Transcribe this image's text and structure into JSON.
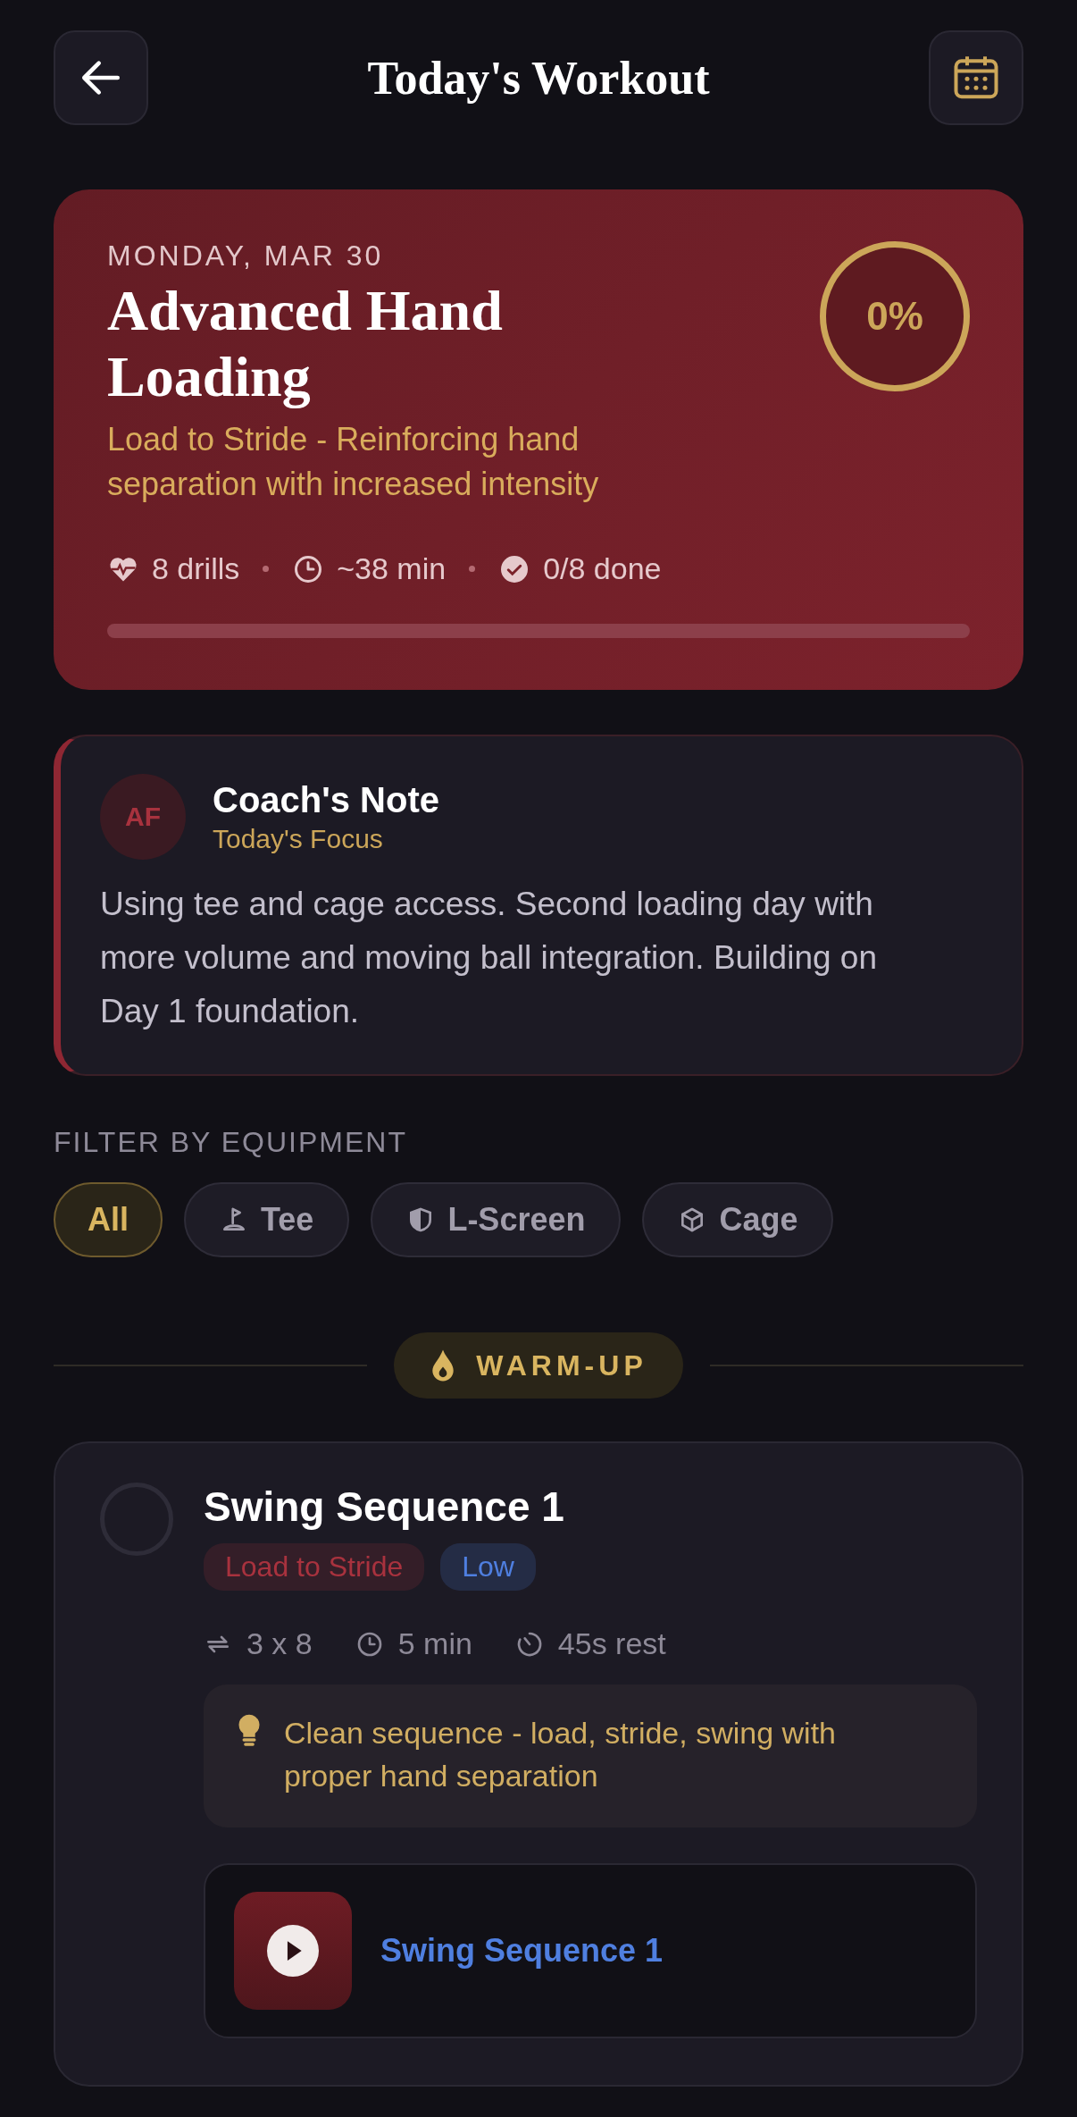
{
  "header": {
    "title": "Today's Workout"
  },
  "hero": {
    "date": "MONDAY, MAR 30",
    "title": "Advanced Hand Loading",
    "subtitle": "Load to Stride - Reinforcing hand separation with increased intensity",
    "percent": "0%",
    "stats": [
      {
        "kind": "drills",
        "text": "8 drills"
      },
      {
        "kind": "time",
        "text": "~38 min"
      },
      {
        "kind": "done",
        "text": "0/8 done"
      }
    ],
    "progress": {
      "level": 0
    }
  },
  "coach_note": {
    "initials": "AF",
    "title": "Coach's Note",
    "subtitle": "Today's Focus",
    "body": "Using tee and cage access. Second loading day with more volume and moving ball integration. Building on Day 1 foundation."
  },
  "filter": {
    "label": "FILTER BY EQUIPMENT",
    "chips": [
      {
        "kind": "all",
        "label": "All",
        "selected": true
      },
      {
        "kind": "tee",
        "label": "Tee",
        "selected": false
      },
      {
        "kind": "screen",
        "label": "L-Screen",
        "selected": false
      },
      {
        "kind": "cage",
        "label": "Cage",
        "selected": false
      }
    ]
  },
  "section": {
    "label": "WARM-UP"
  },
  "drills": [
    {
      "title": "Swing Sequence 1",
      "completed": false,
      "tags": [
        {
          "label": "Load to Stride",
          "color": "#a8323e"
        },
        {
          "label": "Low",
          "color": "#4f7fe0"
        }
      ],
      "meta": [
        {
          "kind": "sets",
          "text": "3 x 8"
        },
        {
          "kind": "time",
          "text": "5 min"
        },
        {
          "kind": "rest",
          "text": "45s rest"
        }
      ],
      "tip": "Clean sequence - load, stride, swing with proper hand separation",
      "video": {
        "title": "Swing Sequence 1"
      }
    }
  ]
}
